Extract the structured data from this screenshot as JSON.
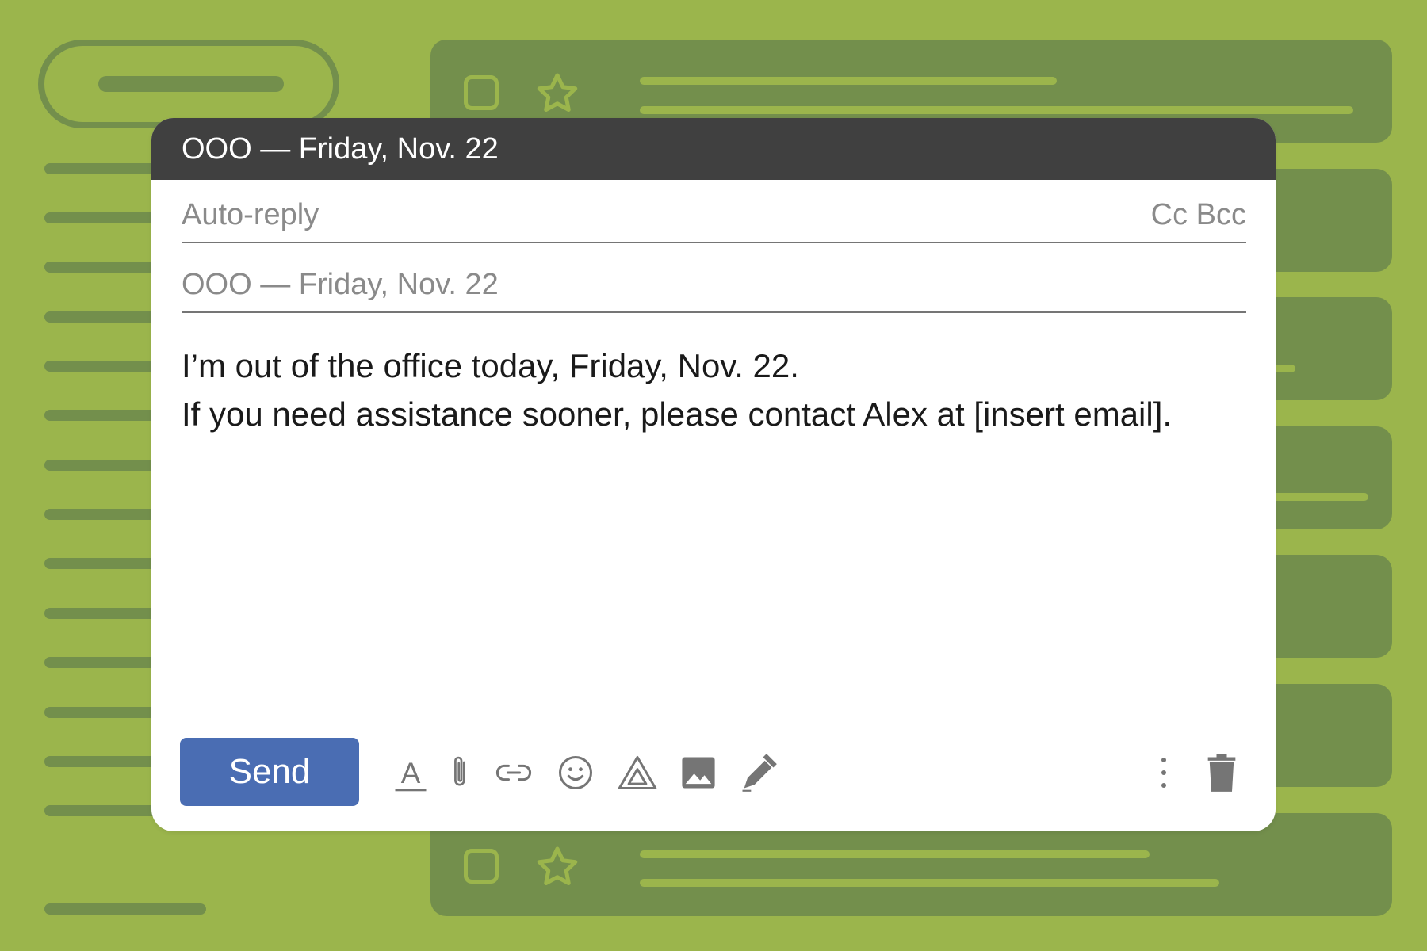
{
  "compose": {
    "window_title": "OOO — Friday, Nov. 22",
    "to_placeholder": "Auto-reply",
    "cc_bcc_label": "Cc Bcc",
    "subject": "OOO — Friday, Nov. 22",
    "body_lines": [
      "I’m out of the office today, Friday, Nov. 22.",
      "If you need assistance sooner, please contact Alex at [insert email]."
    ],
    "send_label": "Send"
  },
  "toolbar": {
    "icons": [
      "format-text-icon",
      "attach-icon",
      "link-icon",
      "emoji-icon",
      "drive-icon",
      "image-icon",
      "signature-pen-icon",
      "more-options-icon",
      "trash-icon"
    ]
  },
  "colors": {
    "background": "#9bb54c",
    "background_accent": "#738f4c",
    "header": "#404040",
    "send_button": "#4a6db3"
  }
}
